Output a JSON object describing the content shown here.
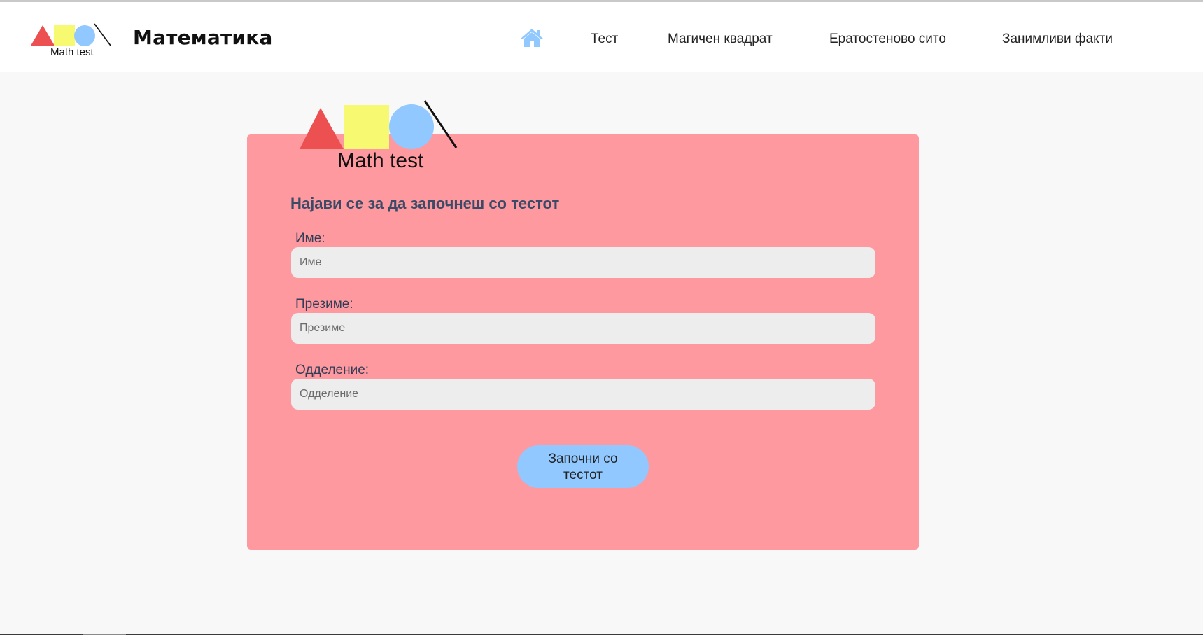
{
  "header": {
    "logo_caption": "Math test",
    "brand_title": "Математика",
    "nav": {
      "home_icon": "home-icon",
      "links": [
        {
          "label": "Тест"
        },
        {
          "label": "Магичен квадрат"
        },
        {
          "label": "Ератостеново сито"
        },
        {
          "label": "Занимливи факти"
        }
      ]
    }
  },
  "form": {
    "logo_caption": "Math test",
    "heading": "Најави се за да започнеш со тестот",
    "fields": [
      {
        "label": "Име:",
        "placeholder": "Име",
        "value": ""
      },
      {
        "label": "Презиме:",
        "placeholder": "Презиме",
        "value": ""
      },
      {
        "label": "Одделение:",
        "placeholder": "Одделение",
        "value": ""
      }
    ],
    "submit_label": "Започни со тестот"
  },
  "colors": {
    "card_background": "#ff99a0",
    "accent_blue": "#90c8ff",
    "logo_red": "#ec5050",
    "logo_yellow": "#f7f970",
    "logo_blue": "#90c8ff",
    "heading_text": "#3b4a66"
  }
}
